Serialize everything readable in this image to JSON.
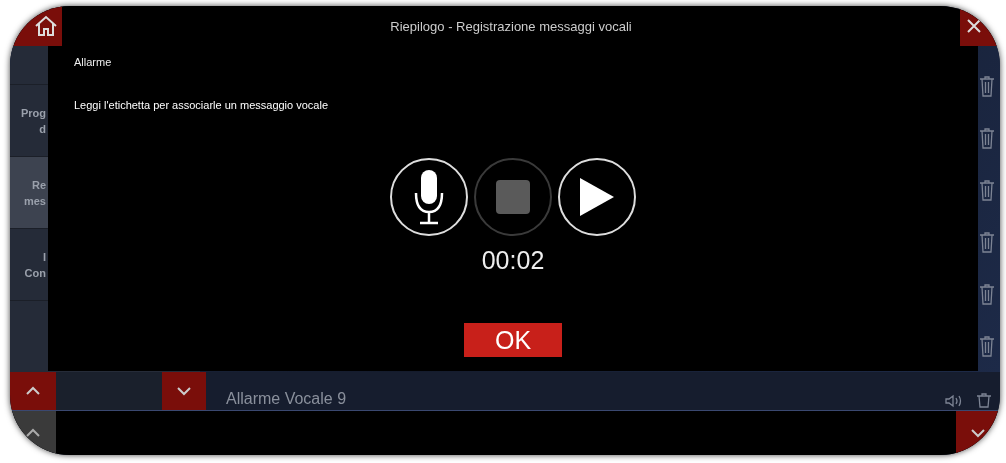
{
  "header": {
    "title": "Riepilogo - Registrazione messaggi vocali"
  },
  "sidebar": {
    "items": [
      {
        "lines": [
          "Prog",
          "d"
        ],
        "selected": false
      },
      {
        "lines": [
          "Re",
          "mes"
        ],
        "selected": true
      },
      {
        "lines": [
          "I",
          "Con"
        ],
        "selected": false
      }
    ]
  },
  "list": {
    "items": [
      {
        "label": "Allarme Vocale 9"
      }
    ]
  },
  "dialog": {
    "title": "Allarme",
    "instruction": "Leggi l'etichetta per associarle un messaggio vocale",
    "controls": [
      {
        "kind": "record",
        "disabled": false
      },
      {
        "kind": "stop",
        "disabled": true
      },
      {
        "kind": "play",
        "disabled": false
      }
    ],
    "timer": "00:02",
    "ok_button": "OK"
  }
}
